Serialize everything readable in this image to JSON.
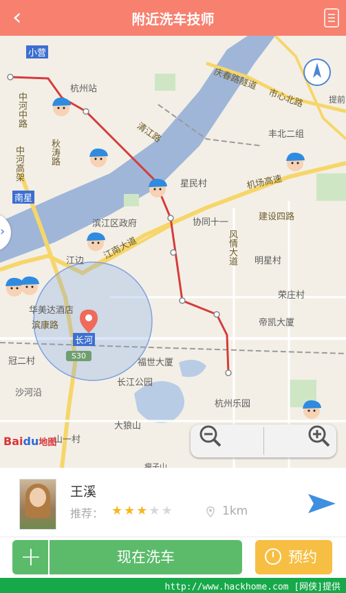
{
  "header": {
    "title": "附近洗车技师",
    "back_icon": "chevron-left-icon",
    "list_icon": "list-icon"
  },
  "map": {
    "labels": {
      "xiaoying": "小营",
      "hangzhou_station": "杭州站",
      "zhonghe_middle": "中河中路",
      "zhonghe_high": "中河高架",
      "qiutao": "秋涛路",
      "qingjiang": "清江路",
      "nanxing": "南星",
      "qingchun_tunnel": "庆春路隧道",
      "shixin_north": "市心北路",
      "fengbei": "丰北二组",
      "xingmin": "星民村",
      "jichang": "机场高速",
      "jianshe4": "建设四路",
      "binjiang_gov": "滨江区政府",
      "xietong": "协同十一",
      "fengqing": "风情大道",
      "mingxing": "明星村",
      "jiangnan": "江南大道",
      "jiangbian": "江边",
      "rongzhuang": "荣庄村",
      "huamei": "华美达酒店",
      "binkang": "滨康路",
      "changhe": "长河",
      "dikai": "帝凯大厦",
      "fushi": "福世大厦",
      "guan2": "冠二村",
      "s30": "S30",
      "changjiang_park": "长江公园",
      "shaheyan": "沙河沿",
      "hangzhou_park": "杭州乐园",
      "dalangshan": "大狼山",
      "shanyi": "山一村",
      "jianshan": "瘦子山",
      "tiqian": "提前"
    },
    "technician_icon": "technician-avatar-icon",
    "location_icon": "current-location-icon",
    "locate_button_icon": "compass-icon",
    "sidebar_toggle": "›",
    "zoom_out_icon": "zoom-out-icon",
    "zoom_in_icon": "zoom-in-icon",
    "logo_text_bai": "Bai",
    "logo_text_du": "du",
    "logo_text_map": "地图"
  },
  "technician": {
    "name": "王溪",
    "recommend_label": "推荐：",
    "rating": 3,
    "rating_max": 5,
    "distance": "1km",
    "distance_icon": "location-pin-icon",
    "navigate_icon": "navigate-arrow-icon"
  },
  "actions": {
    "add_icon": "plus-icon",
    "add_label": "+",
    "wash_now": "现在洗车",
    "book_icon": "clock-icon",
    "book": "预约"
  },
  "footer": {
    "watermark": "http://www.hackhome.com [网侠]提供"
  },
  "colors": {
    "header": "#f7806f",
    "primary_green": "#5cbb6b",
    "book_orange": "#f6bf43",
    "star_on": "#f6b71c",
    "footer_green": "#17a84a"
  }
}
